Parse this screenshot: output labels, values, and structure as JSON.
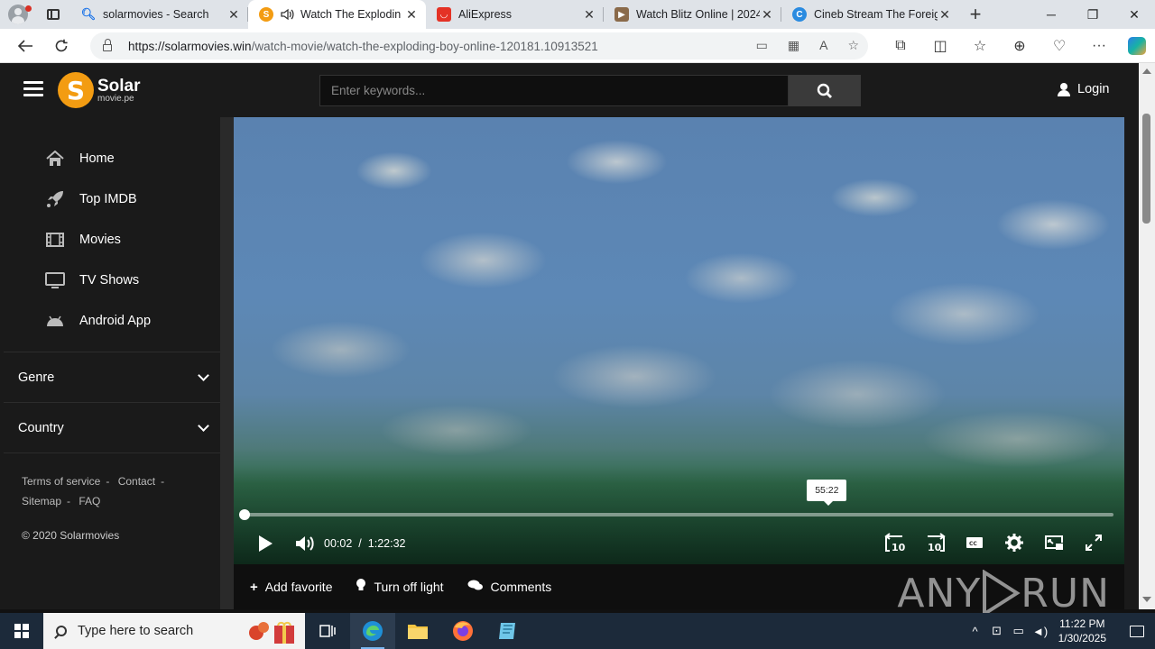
{
  "browser": {
    "tabs": [
      {
        "title": "solarmovies - Search",
        "favicon": "search-icon"
      },
      {
        "title": "Watch The Explodin",
        "favicon": "solarmovies-icon"
      },
      {
        "title": "AliExpress",
        "favicon": "aliexpress-icon"
      },
      {
        "title": "Watch Blitz Online | 2024",
        "favicon": "video-icon"
      },
      {
        "title": "Cineb Stream The Foreig",
        "favicon": "cineb-icon"
      }
    ],
    "active_tab_index": 1,
    "url_host": "https://solarmovies.win",
    "url_path": "/watch-movie/watch-the-exploding-boy-online-120181.10913521"
  },
  "site": {
    "logo": {
      "letter": "S",
      "line1": "Solar",
      "line2": "movie.pe"
    },
    "search": {
      "placeholder": "Enter keywords..."
    },
    "login_label": "Login",
    "menu": [
      {
        "label": "Home",
        "icon": "home-icon"
      },
      {
        "label": "Top IMDB",
        "icon": "rocket-icon"
      },
      {
        "label": "Movies",
        "icon": "film-icon"
      },
      {
        "label": "TV Shows",
        "icon": "tv-icon"
      },
      {
        "label": "Android App",
        "icon": "android-icon"
      }
    ],
    "genre_label": "Genre",
    "country_label": "Country",
    "footer": {
      "terms": "Terms of service",
      "contact": "Contact",
      "sitemap": "Sitemap",
      "faq": "FAQ",
      "sep": "-",
      "copyright": "© 2020 Solarmovies"
    }
  },
  "player": {
    "current_time": "00:02",
    "time_sep": "/",
    "duration": "1:22:32",
    "hover_time": "55:22",
    "progress_fraction": 0.0004,
    "hover_fraction": 0.67
  },
  "actions": {
    "favorite": "Add favorite",
    "light": "Turn off light",
    "comments": "Comments"
  },
  "watermark": {
    "left": "ANY",
    "right": "RUN"
  },
  "taskbar": {
    "search_placeholder": "Type here to search",
    "time": "11:22 PM",
    "date": "1/30/2025"
  }
}
